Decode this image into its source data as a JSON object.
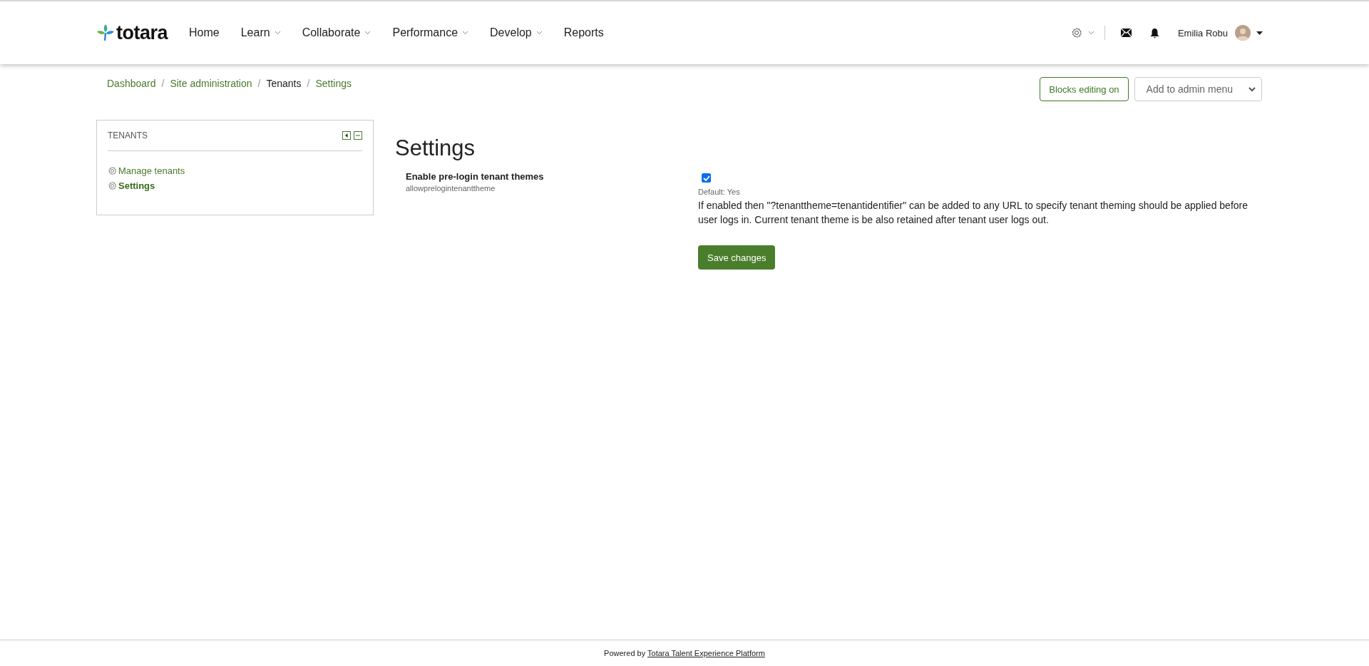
{
  "header": {
    "logo": "totara",
    "nav": [
      {
        "label": "Home",
        "has_menu": false
      },
      {
        "label": "Learn",
        "has_menu": true
      },
      {
        "label": "Collaborate",
        "has_menu": true
      },
      {
        "label": "Performance",
        "has_menu": true
      },
      {
        "label": "Develop",
        "has_menu": true
      },
      {
        "label": "Reports",
        "has_menu": false
      }
    ],
    "user": "Emilia Robu"
  },
  "breadcrumb_separator": "/",
  "breadcrumb": [
    {
      "label": "Dashboard",
      "link": true
    },
    {
      "label": "Site administration",
      "link": true
    },
    {
      "label": "Tenants",
      "link": false
    },
    {
      "label": "Settings",
      "link": true
    }
  ],
  "actions": {
    "blocks_button": "Blocks editing on",
    "admin_menu": {
      "value": "Add to admin menu"
    }
  },
  "block": {
    "title": "TENANTS",
    "items": [
      {
        "label": "Manage tenants",
        "selected": false
      },
      {
        "label": "Settings",
        "selected": true
      }
    ]
  },
  "main": {
    "heading": "Settings",
    "setting": {
      "label": "Enable pre-login tenant themes",
      "name": "allowprelogintenanttheme",
      "checked": true,
      "default": "Default: Yes",
      "description": "If enabled then \"?tenanttheme=tenantidentifier\" can be added to any URL to specify tenant theming should be applied before user logs in. Current tenant theme is be also retained after tenant user logs out."
    },
    "save_button": "Save changes"
  },
  "footer": {
    "prefix": "Powered by",
    "link": "Totara Talent Experience Platform"
  }
}
